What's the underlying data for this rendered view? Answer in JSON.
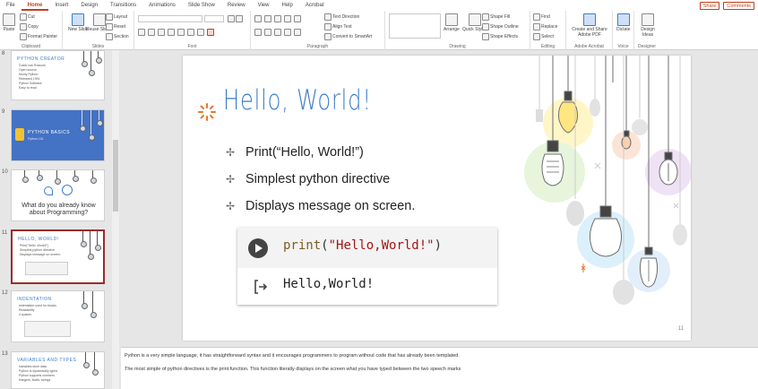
{
  "menu": {
    "tabs": [
      "File",
      "Home",
      "Insert",
      "Design",
      "Transitions",
      "Animations",
      "Slide Show",
      "Review",
      "View",
      "Help",
      "Acrobat"
    ],
    "active": "Home",
    "share_label": "Share",
    "comments_label": "Comments"
  },
  "ribbon": {
    "clipboard": {
      "paste": "Paste",
      "cut": "Cut",
      "copy": "Copy",
      "format_painter": "Format Painter",
      "label": "Clipboard"
    },
    "slides": {
      "new_slide": "New Slide",
      "reuse_slides": "Reuse Slides",
      "layout": "Layout",
      "reset": "Reset",
      "section": "Section",
      "label": "Slides"
    },
    "font": {
      "label": "Font"
    },
    "paragraph": {
      "text_direction": "Text Direction",
      "align_text": "Align Text",
      "convert_smartart": "Convert to SmartArt",
      "label": "Paragraph"
    },
    "drawing": {
      "arrange": "Arrange",
      "quick_styles": "Quick Styles",
      "shape_fill": "Shape Fill",
      "shape_outline": "Shape Outline",
      "shape_effects": "Shape Effects",
      "label": "Drawing"
    },
    "editing": {
      "find": "Find",
      "replace": "Replace",
      "select": "Select",
      "label": "Editing"
    },
    "acrobat": {
      "create_share": "Create and Share Adobe PDF",
      "label": "Adobe Acrobat"
    },
    "voice": {
      "dictate": "Dictate",
      "label": "Voice"
    },
    "designer": {
      "design_ideas": "Design Ideas",
      "label": "Designer"
    }
  },
  "thumbnails": [
    {
      "num": "8",
      "title": "PYTHON CREATOR",
      "lines": [
        "Guido van Rossum",
        "Open source",
        "Monty Python",
        "Released 1991",
        "Python Software",
        "Easy to read"
      ]
    },
    {
      "num": "9",
      "title": "PYTHON BASICS",
      "subtitle": "Python 101"
    },
    {
      "num": "10",
      "title": "",
      "caption": "What do you already know about Programming?"
    },
    {
      "num": "11",
      "title": "HELLO, WORLD!",
      "lines": [
        "Print(\"Hello, World!\")",
        "Simplest python directive",
        "Displays message on screen."
      ]
    },
    {
      "num": "12",
      "title": "INDENTATION",
      "lines": [
        "Indentation used for blocks",
        "Readability",
        "4 spaces"
      ]
    },
    {
      "num": "13",
      "title": "VARIABLES AND TYPES",
      "lines": [
        "Variables store data",
        "Python is dynamically typed",
        "Python supports numbers",
        "Integers, floats, strings"
      ]
    }
  ],
  "slide": {
    "title": "Hello, World!",
    "bullets": [
      "Print(“Hello, World!”)",
      "Simplest python directive",
      "Displays message on screen."
    ],
    "code_fn": "print",
    "code_open": "(",
    "code_str": "\"Hello,World!\"",
    "code_close": ")",
    "output": "Hello,World!",
    "page_number": "11"
  },
  "notes": [
    "Python is a very simple language, it has straightforward syntax and it encourages programmers to program without code that has already been templated.",
    "The most simple of python directives is the print function. This function literally displays on the screen what you have typed between the two speech marks"
  ],
  "colors": {
    "accent": "#c43e1c",
    "title_blue": "#3d7cc9",
    "selected_border": "#9b2c2c"
  }
}
